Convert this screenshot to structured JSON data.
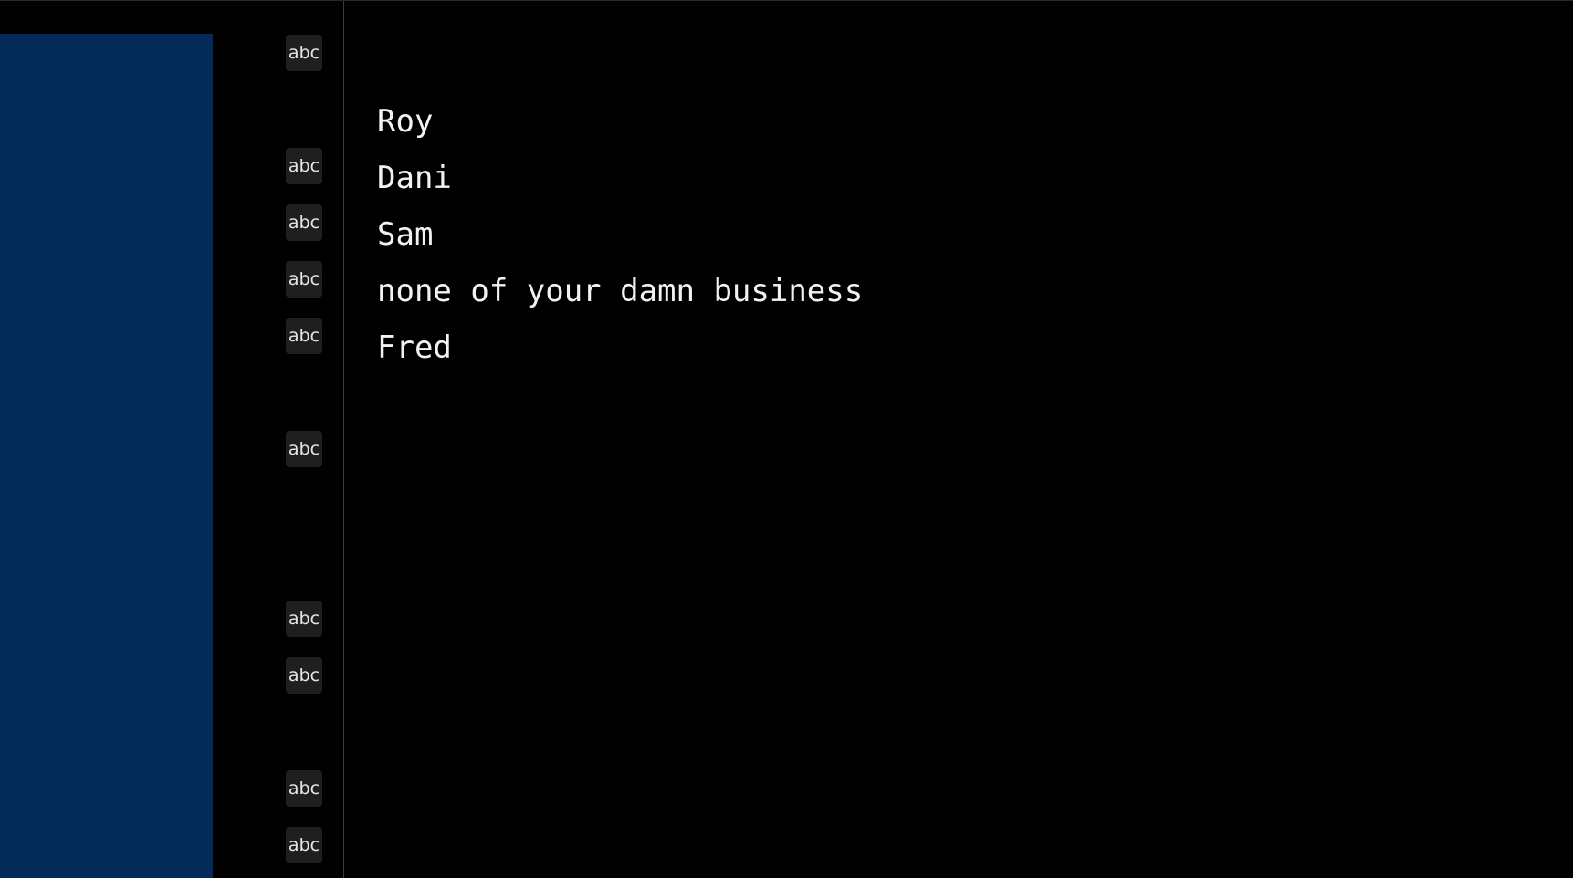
{
  "gutter": {
    "badges": [
      "abc",
      "abc",
      "abc",
      "abc",
      "abc",
      "abc",
      "abc",
      "abc",
      "abc",
      "abc"
    ]
  },
  "editor": {
    "lines": [
      "Roy",
      "Dani",
      "Sam",
      "none of your damn business",
      "Fred"
    ]
  },
  "colors": {
    "background": "#000000",
    "left_panel": "#042a5a",
    "badge_bg": "#1f1f1f",
    "text": "#f2f2f2"
  }
}
